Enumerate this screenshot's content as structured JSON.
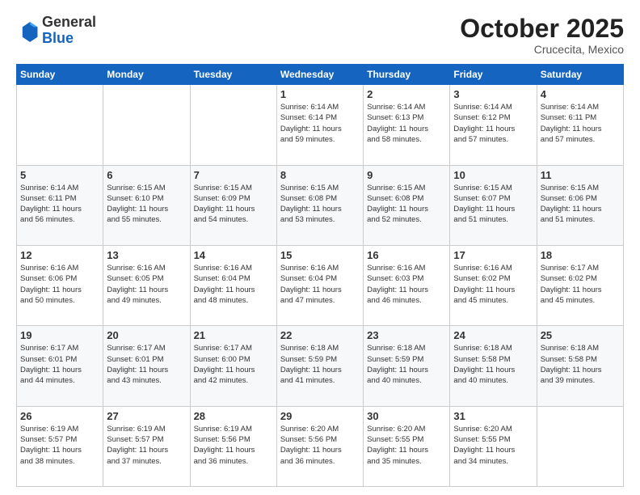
{
  "header": {
    "logo_general": "General",
    "logo_blue": "Blue",
    "month_title": "October 2025",
    "subtitle": "Crucecita, Mexico"
  },
  "weekdays": [
    "Sunday",
    "Monday",
    "Tuesday",
    "Wednesday",
    "Thursday",
    "Friday",
    "Saturday"
  ],
  "weeks": [
    [
      {
        "day": "",
        "info": ""
      },
      {
        "day": "",
        "info": ""
      },
      {
        "day": "",
        "info": ""
      },
      {
        "day": "1",
        "info": "Sunrise: 6:14 AM\nSunset: 6:14 PM\nDaylight: 11 hours\nand 59 minutes."
      },
      {
        "day": "2",
        "info": "Sunrise: 6:14 AM\nSunset: 6:13 PM\nDaylight: 11 hours\nand 58 minutes."
      },
      {
        "day": "3",
        "info": "Sunrise: 6:14 AM\nSunset: 6:12 PM\nDaylight: 11 hours\nand 57 minutes."
      },
      {
        "day": "4",
        "info": "Sunrise: 6:14 AM\nSunset: 6:11 PM\nDaylight: 11 hours\nand 57 minutes."
      }
    ],
    [
      {
        "day": "5",
        "info": "Sunrise: 6:14 AM\nSunset: 6:11 PM\nDaylight: 11 hours\nand 56 minutes."
      },
      {
        "day": "6",
        "info": "Sunrise: 6:15 AM\nSunset: 6:10 PM\nDaylight: 11 hours\nand 55 minutes."
      },
      {
        "day": "7",
        "info": "Sunrise: 6:15 AM\nSunset: 6:09 PM\nDaylight: 11 hours\nand 54 minutes."
      },
      {
        "day": "8",
        "info": "Sunrise: 6:15 AM\nSunset: 6:08 PM\nDaylight: 11 hours\nand 53 minutes."
      },
      {
        "day": "9",
        "info": "Sunrise: 6:15 AM\nSunset: 6:08 PM\nDaylight: 11 hours\nand 52 minutes."
      },
      {
        "day": "10",
        "info": "Sunrise: 6:15 AM\nSunset: 6:07 PM\nDaylight: 11 hours\nand 51 minutes."
      },
      {
        "day": "11",
        "info": "Sunrise: 6:15 AM\nSunset: 6:06 PM\nDaylight: 11 hours\nand 51 minutes."
      }
    ],
    [
      {
        "day": "12",
        "info": "Sunrise: 6:16 AM\nSunset: 6:06 PM\nDaylight: 11 hours\nand 50 minutes."
      },
      {
        "day": "13",
        "info": "Sunrise: 6:16 AM\nSunset: 6:05 PM\nDaylight: 11 hours\nand 49 minutes."
      },
      {
        "day": "14",
        "info": "Sunrise: 6:16 AM\nSunset: 6:04 PM\nDaylight: 11 hours\nand 48 minutes."
      },
      {
        "day": "15",
        "info": "Sunrise: 6:16 AM\nSunset: 6:04 PM\nDaylight: 11 hours\nand 47 minutes."
      },
      {
        "day": "16",
        "info": "Sunrise: 6:16 AM\nSunset: 6:03 PM\nDaylight: 11 hours\nand 46 minutes."
      },
      {
        "day": "17",
        "info": "Sunrise: 6:16 AM\nSunset: 6:02 PM\nDaylight: 11 hours\nand 45 minutes."
      },
      {
        "day": "18",
        "info": "Sunrise: 6:17 AM\nSunset: 6:02 PM\nDaylight: 11 hours\nand 45 minutes."
      }
    ],
    [
      {
        "day": "19",
        "info": "Sunrise: 6:17 AM\nSunset: 6:01 PM\nDaylight: 11 hours\nand 44 minutes."
      },
      {
        "day": "20",
        "info": "Sunrise: 6:17 AM\nSunset: 6:01 PM\nDaylight: 11 hours\nand 43 minutes."
      },
      {
        "day": "21",
        "info": "Sunrise: 6:17 AM\nSunset: 6:00 PM\nDaylight: 11 hours\nand 42 minutes."
      },
      {
        "day": "22",
        "info": "Sunrise: 6:18 AM\nSunset: 5:59 PM\nDaylight: 11 hours\nand 41 minutes."
      },
      {
        "day": "23",
        "info": "Sunrise: 6:18 AM\nSunset: 5:59 PM\nDaylight: 11 hours\nand 40 minutes."
      },
      {
        "day": "24",
        "info": "Sunrise: 6:18 AM\nSunset: 5:58 PM\nDaylight: 11 hours\nand 40 minutes."
      },
      {
        "day": "25",
        "info": "Sunrise: 6:18 AM\nSunset: 5:58 PM\nDaylight: 11 hours\nand 39 minutes."
      }
    ],
    [
      {
        "day": "26",
        "info": "Sunrise: 6:19 AM\nSunset: 5:57 PM\nDaylight: 11 hours\nand 38 minutes."
      },
      {
        "day": "27",
        "info": "Sunrise: 6:19 AM\nSunset: 5:57 PM\nDaylight: 11 hours\nand 37 minutes."
      },
      {
        "day": "28",
        "info": "Sunrise: 6:19 AM\nSunset: 5:56 PM\nDaylight: 11 hours\nand 36 minutes."
      },
      {
        "day": "29",
        "info": "Sunrise: 6:20 AM\nSunset: 5:56 PM\nDaylight: 11 hours\nand 36 minutes."
      },
      {
        "day": "30",
        "info": "Sunrise: 6:20 AM\nSunset: 5:55 PM\nDaylight: 11 hours\nand 35 minutes."
      },
      {
        "day": "31",
        "info": "Sunrise: 6:20 AM\nSunset: 5:55 PM\nDaylight: 11 hours\nand 34 minutes."
      },
      {
        "day": "",
        "info": ""
      }
    ]
  ]
}
